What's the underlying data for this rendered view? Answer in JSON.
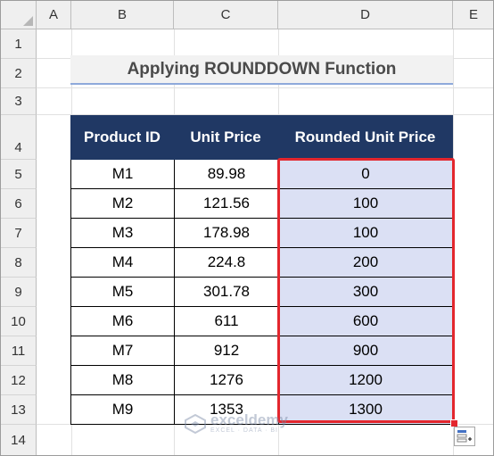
{
  "sheet": {
    "columns": [
      "A",
      "B",
      "C",
      "D",
      "E"
    ],
    "rows": [
      "1",
      "2",
      "3",
      "4",
      "5",
      "6",
      "7",
      "8",
      "9",
      "10",
      "11",
      "12",
      "13",
      "14"
    ]
  },
  "title": "Applying ROUNDDOWN Function",
  "table": {
    "headers": [
      "Product ID",
      "Unit Price",
      "Rounded Unit Price"
    ],
    "rows": [
      {
        "id": "M1",
        "price": "89.98",
        "rounded": "0"
      },
      {
        "id": "M2",
        "price": "121.56",
        "rounded": "100"
      },
      {
        "id": "M3",
        "price": "178.98",
        "rounded": "100"
      },
      {
        "id": "M4",
        "price": "224.8",
        "rounded": "200"
      },
      {
        "id": "M5",
        "price": "301.78",
        "rounded": "300"
      },
      {
        "id": "M6",
        "price": "611",
        "rounded": "600"
      },
      {
        "id": "M7",
        "price": "912",
        "rounded": "900"
      },
      {
        "id": "M8",
        "price": "1276",
        "rounded": "1200"
      },
      {
        "id": "M9",
        "price": "1353",
        "rounded": "1300"
      }
    ]
  },
  "watermark": {
    "name": "exceldemy",
    "tagline": "EXCEL · DATA · BI"
  },
  "colors": {
    "header_bg": "#203864",
    "selection_fill": "#dbe0f4",
    "selection_border": "#e3262d",
    "title_underline": "#8ea9db"
  },
  "icons": {
    "quick_analysis": "quick-analysis-icon",
    "select_all": "select-all-icon"
  }
}
